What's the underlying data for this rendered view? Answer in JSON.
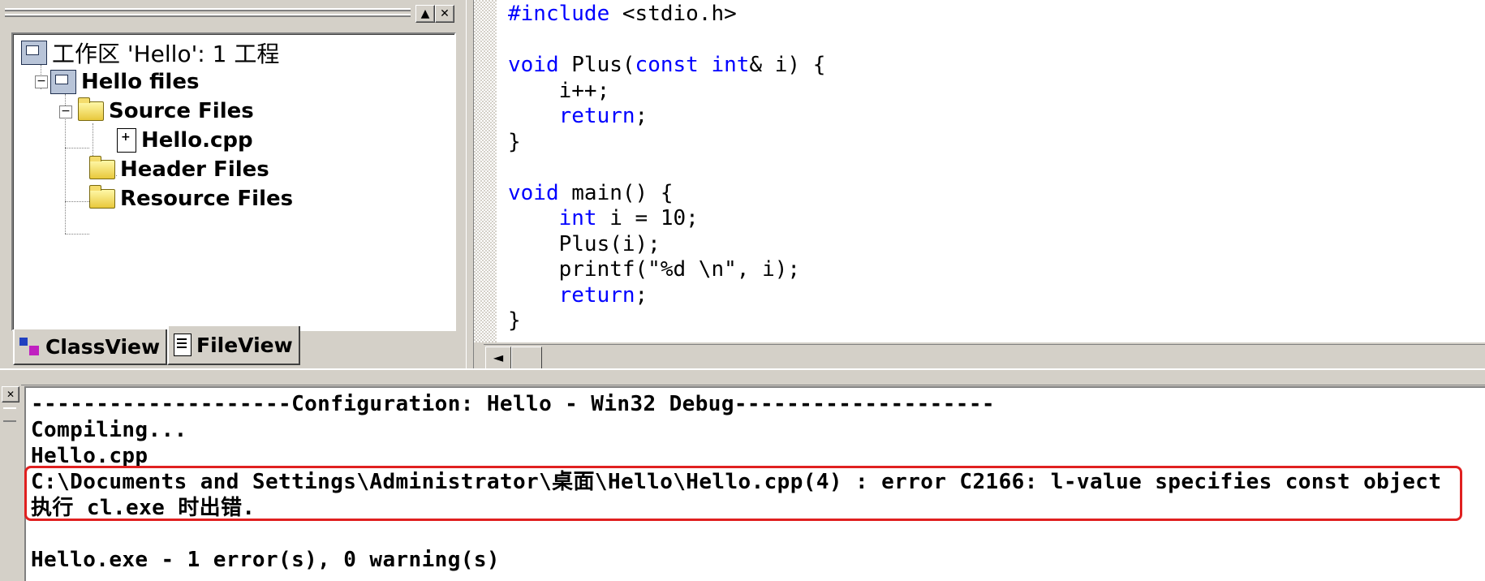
{
  "workspace": {
    "close_glyph": "✕",
    "min_glyph": "▲",
    "tree": {
      "root": "工作区 'Hello': 1 工程",
      "project": "Hello files",
      "source_folder": "Source Files",
      "source_file": "Hello.cpp",
      "header_folder": "Header Files",
      "resource_folder": "Resource Files",
      "collapse_glyph": "−"
    },
    "tabs": [
      {
        "label": "ClassView"
      },
      {
        "label": "FileView"
      }
    ],
    "active_tab": "FileView"
  },
  "editor": {
    "lines": [
      [
        {
          "t": "#include",
          "kw": true
        },
        {
          "t": " <stdio.h>"
        }
      ],
      [],
      [
        {
          "t": "void",
          "kw": true
        },
        {
          "t": " Plus("
        },
        {
          "t": "const",
          "kw": true
        },
        {
          "t": " "
        },
        {
          "t": "int",
          "kw": true
        },
        {
          "t": "& i) {"
        }
      ],
      [
        {
          "t": "    i++;"
        }
      ],
      [
        {
          "t": "    "
        },
        {
          "t": "return",
          "kw": true
        },
        {
          "t": ";"
        }
      ],
      [
        {
          "t": "}"
        }
      ],
      [],
      [
        {
          "t": "void",
          "kw": true
        },
        {
          "t": " main() {"
        }
      ],
      [
        {
          "t": "    "
        },
        {
          "t": "int",
          "kw": true
        },
        {
          "t": " i = 10;"
        }
      ],
      [
        {
          "t": "    Plus(i);"
        }
      ],
      [
        {
          "t": "    printf(\"%d \\n\", i);"
        }
      ],
      [
        {
          "t": "    "
        },
        {
          "t": "return",
          "kw": true
        },
        {
          "t": ";"
        }
      ],
      [
        {
          "t": "}"
        }
      ]
    ],
    "keyword_color": "#0000ff",
    "scroll_left_glyph": "◄"
  },
  "output": {
    "close_glyph": "✕",
    "lines": [
      "--------------------Configuration: Hello - Win32 Debug--------------------",
      "Compiling...",
      "Hello.cpp",
      "C:\\Documents and Settings\\Administrator\\桌面\\Hello\\Hello.cpp(4) : error C2166: l-value specifies const object",
      "执行 cl.exe 时出错.",
      "",
      "Hello.exe - 1 error(s), 0 warning(s)"
    ],
    "highlight_color": "#e02020"
  }
}
